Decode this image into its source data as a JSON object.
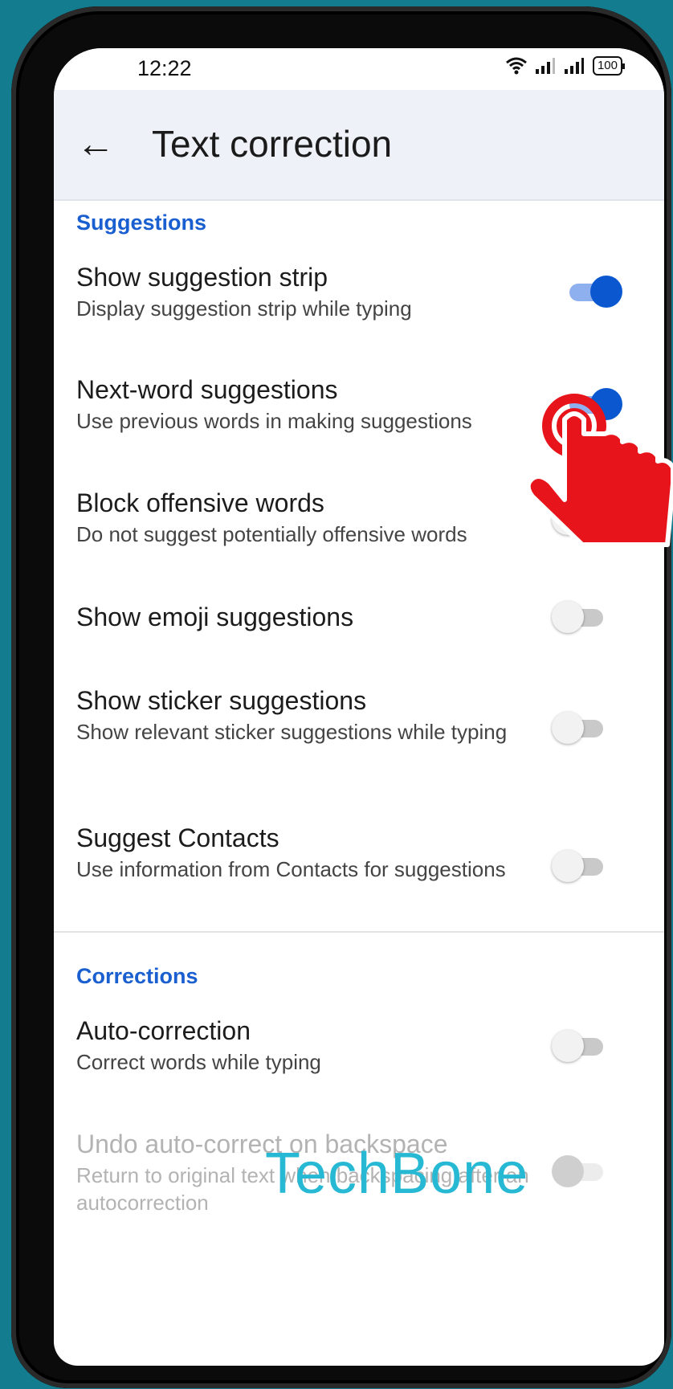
{
  "status_bar": {
    "time": "12:22",
    "battery": "100"
  },
  "app_bar": {
    "title": "Text correction",
    "back_icon": "arrow-left-icon"
  },
  "sections": {
    "suggestions_header": "Suggestions",
    "corrections_header": "Corrections"
  },
  "items": [
    {
      "title": "Show suggestion strip",
      "subtitle": "Display suggestion strip while typing",
      "enabled": true,
      "on": true
    },
    {
      "title": "Next-word suggestions",
      "subtitle": "Use previous words in making suggestions",
      "enabled": true,
      "on": true
    },
    {
      "title": "Block offensive words",
      "subtitle": "Do not suggest potentially offensive words",
      "enabled": true,
      "on": false
    },
    {
      "title": "Show emoji suggestions",
      "subtitle": "",
      "enabled": true,
      "on": false
    },
    {
      "title": "Show sticker suggestions",
      "subtitle": "Show relevant sticker suggestions while typing",
      "enabled": true,
      "on": false
    },
    {
      "title": "Suggest Contacts",
      "subtitle": "Use information from Contacts for suggestions",
      "enabled": true,
      "on": false
    },
    {
      "title": "Auto-correction",
      "subtitle": "Correct words while typing",
      "enabled": true,
      "on": false
    },
    {
      "title": "Undo auto-correct on backspace",
      "subtitle": "Return to original text when backspacing after an autocorrection",
      "enabled": false,
      "on": false
    }
  ],
  "watermark": "TechBone",
  "colors": {
    "accent": "#0b57d0",
    "section_header": "#1a5fd0",
    "appbar_bg": "#eef2f8",
    "background": "#137d8f",
    "pointer": "#e8141b"
  }
}
